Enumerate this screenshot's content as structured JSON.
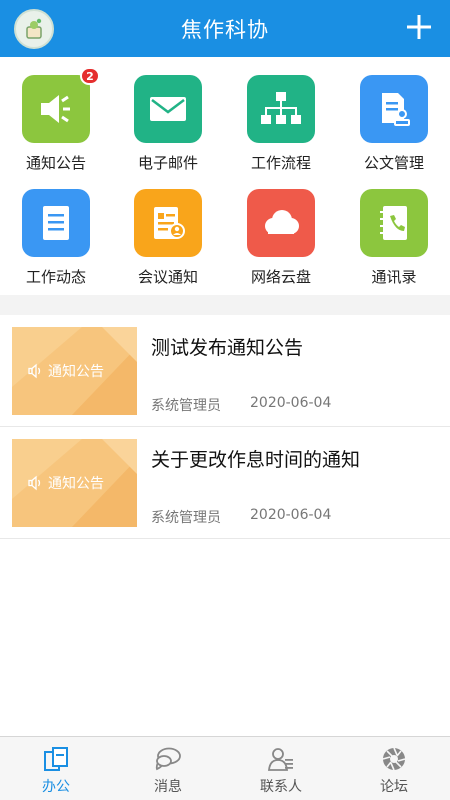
{
  "header": {
    "title": "焦作科协",
    "add_icon": "plus-icon",
    "avatar_icon": "avatar-icon"
  },
  "grid": {
    "items": [
      {
        "label": "通知公告",
        "icon": "speaker-icon",
        "color": "#8cc63e",
        "badge": "2"
      },
      {
        "label": "电子邮件",
        "icon": "mail-icon",
        "color": "#21b386"
      },
      {
        "label": "工作流程",
        "icon": "flowchart-icon",
        "color": "#21b386"
      },
      {
        "label": "公文管理",
        "icon": "document-stamp-icon",
        "color": "#3a97f3"
      },
      {
        "label": "工作动态",
        "icon": "notes-icon",
        "color": "#3a97f3"
      },
      {
        "label": "会议通知",
        "icon": "meeting-icon",
        "color": "#f9a51b"
      },
      {
        "label": "网络云盘",
        "icon": "cloud-icon",
        "color": "#ef5a4a"
      },
      {
        "label": "通讯录",
        "icon": "contacts-book-icon",
        "color": "#8cc63e"
      }
    ]
  },
  "news": [
    {
      "thumb_label": "通知公告",
      "title": "测试发布通知公告",
      "author": "系统管理员",
      "date": "2020-06-04"
    },
    {
      "thumb_label": "通知公告",
      "title": "关于更改作息时间的通知",
      "author": "系统管理员",
      "date": "2020-06-04"
    }
  ],
  "nav": {
    "items": [
      {
        "label": "办公",
        "icon": "office-icon",
        "active": true
      },
      {
        "label": "消息",
        "icon": "chat-icon"
      },
      {
        "label": "联系人",
        "icon": "contacts-icon"
      },
      {
        "label": "论坛",
        "icon": "forum-icon"
      }
    ],
    "active_color": "#1a8fe3"
  }
}
